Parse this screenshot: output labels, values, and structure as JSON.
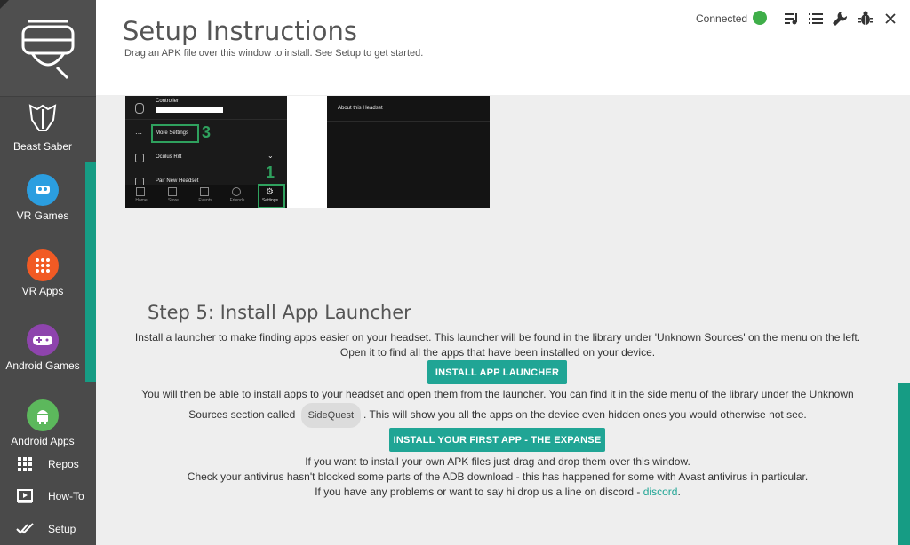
{
  "sidebar": {
    "items": [
      {
        "label": "Beast Saber",
        "icon": "beast-saber-icon"
      },
      {
        "label": "VR Games",
        "icon": "vr-games-icon",
        "color": "#2b9ee0"
      },
      {
        "label": "VR Apps",
        "icon": "vr-apps-icon",
        "color": "#f15a24"
      },
      {
        "label": "Android Games",
        "icon": "gamepad-icon",
        "color": "#8e44ad"
      },
      {
        "label": "Android Apps",
        "icon": "android-icon",
        "color": "#5cb85c"
      }
    ],
    "bottom": [
      {
        "label": "Repos",
        "icon": "grid-icon"
      },
      {
        "label": "How-To",
        "icon": "video-icon"
      },
      {
        "label": "Setup",
        "icon": "check-icon"
      }
    ]
  },
  "header": {
    "title": "Setup Instructions",
    "subtitle": "Drag an APK file over this window to install. See Setup to get started.",
    "status": "Connected",
    "status_color": "#3fae49"
  },
  "screenshot": {
    "rows": [
      "Controller",
      "More Settings",
      "Oculus Rift",
      "Pair New Headset"
    ],
    "tabs": [
      "Home",
      "Store",
      "Events",
      "Friends",
      "Settings"
    ],
    "marker_1": "1",
    "marker_3": "3",
    "right_title": "About this Headset"
  },
  "step5": {
    "title": "Step 5: Install App Launcher",
    "line1": "Install a launcher to make finding apps easier on your headset. This launcher will be found in the library under 'Unknown Sources' on the menu on the left.",
    "line2": "Open it to find all the apps that have been installed on your device.",
    "btn_launcher": "INSTALL APP LAUNCHER",
    "line3": "You will then be able to install apps to your headset and open them from the launcher. You can find it in the side menu of the library under the Unknown",
    "line4_pre": "Sources section called",
    "chip": "SideQuest",
    "line4_post": ". This will show you all the apps on the device even hidden ones you would otherwise not see.",
    "btn_first_app": "INSTALL YOUR FIRST APP - THE EXPANSE",
    "line5": "If you want to install your own APK files just drag and drop them over this window.",
    "line6": "Check your antivirus hasn't blocked some parts of the ADB download - this has happened for some with Avast antivirus in particular.",
    "line7_pre": "If you have any problems or want to say hi drop us a line on discord -",
    "link": "discord",
    "line7_post": "."
  },
  "colors": {
    "accent": "#169c84",
    "button": "#20a595",
    "sidebar": "#4a4a4a"
  }
}
